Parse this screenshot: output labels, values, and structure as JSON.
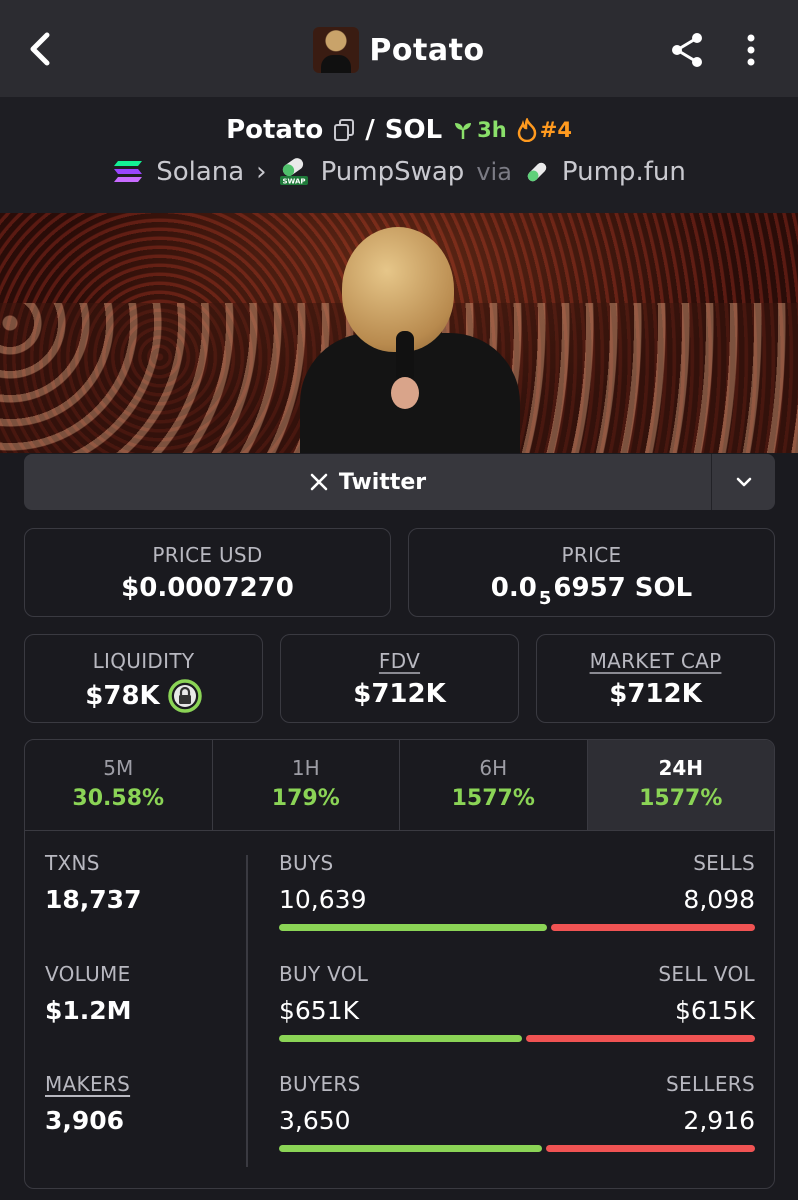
{
  "app": {
    "title": "Potato"
  },
  "pair": {
    "base": "Potato",
    "separator": "/",
    "quote": "SOL",
    "age": "3h",
    "rank": "#4",
    "chain": "Solana",
    "dex": "PumpSwap",
    "via_label": "via",
    "launchpad": "Pump.fun"
  },
  "social": {
    "twitter_label": "Twitter"
  },
  "prices": {
    "price_usd_label": "PRICE USD",
    "price_usd": "$0.0007270",
    "price_label": "PRICE",
    "price_prefix": "0.0",
    "price_subscript": "5",
    "price_suffix": "6957 SOL"
  },
  "metrics": {
    "liquidity_label": "LIQUIDITY",
    "liquidity": "$78K",
    "fdv_label": "FDV",
    "fdv": "$712K",
    "market_cap_label": "MARKET CAP",
    "market_cap": "$712K"
  },
  "timeframes": [
    {
      "label": "5M",
      "change": "30.58%"
    },
    {
      "label": "1H",
      "change": "179%"
    },
    {
      "label": "6H",
      "change": "1577%"
    },
    {
      "label": "24H",
      "change": "1577%",
      "active": true
    }
  ],
  "stats": {
    "txns_label": "TXNS",
    "txns": "18,737",
    "volume_label": "VOLUME",
    "volume": "$1.2M",
    "makers_label": "MAKERS",
    "makers": "3,906",
    "buys_label": "BUYS",
    "buys": "10,639",
    "sells_label": "SELLS",
    "sells": "8,098",
    "buys_ratio": 0.568,
    "buy_vol_label": "BUY VOL",
    "buy_vol": "$651K",
    "sell_vol_label": "SELL VOL",
    "sell_vol": "$615K",
    "buy_vol_ratio": 0.514,
    "buyers_label": "BUYERS",
    "buyers": "3,650",
    "sellers_label": "SELLERS",
    "sellers": "2,916",
    "buyers_ratio": 0.556
  },
  "colors": {
    "positive": "#8bd456",
    "negative": "#f05353",
    "age": "#8ae06a",
    "rank": "#ff9a1f"
  }
}
